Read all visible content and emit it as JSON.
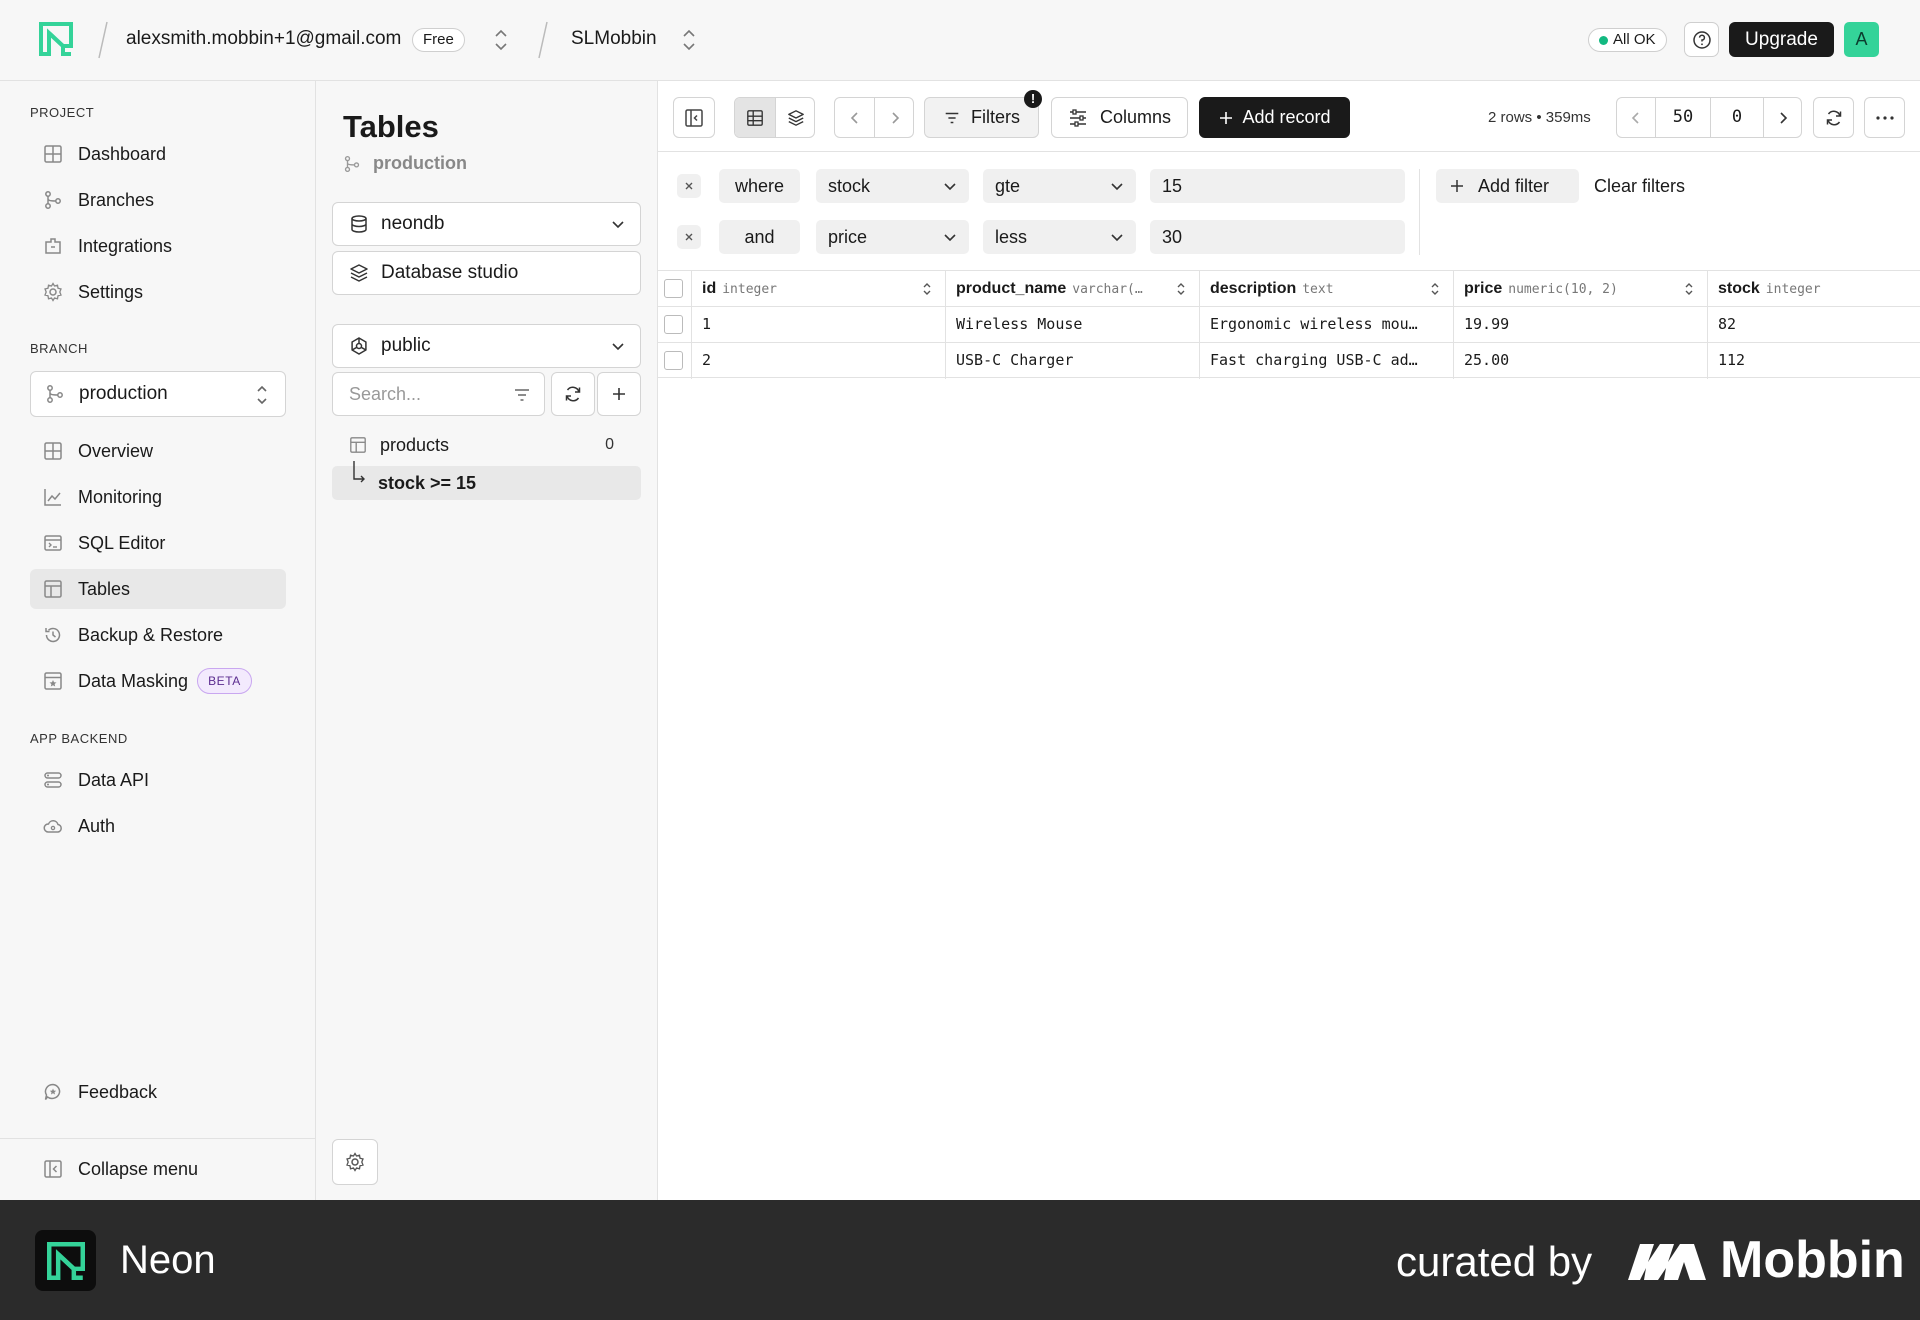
{
  "topbar": {
    "account_email": "alexsmith.mobbin+1@gmail.com",
    "plan_badge": "Free",
    "project_name": "SLMobbin",
    "status": "All OK",
    "upgrade_label": "Upgrade",
    "avatar_letter": "A"
  },
  "sidebar": {
    "project_label": "PROJECT",
    "project_items": [
      "Dashboard",
      "Branches",
      "Integrations",
      "Settings"
    ],
    "branch_label": "BRANCH",
    "branch_value": "production",
    "branch_items": [
      "Overview",
      "Monitoring",
      "SQL Editor",
      "Tables",
      "Backup & Restore",
      "Data Masking"
    ],
    "beta_badge": "BETA",
    "app_backend_label": "APP BACKEND",
    "backend_items": [
      "Data API",
      "Auth"
    ],
    "feedback_label": "Feedback",
    "collapse_label": "Collapse menu"
  },
  "tables_panel": {
    "title": "Tables",
    "branch": "production",
    "database": "neondb",
    "studio_label": "Database studio",
    "schema": "public",
    "search_placeholder": "Search...",
    "table_name": "products",
    "table_count": "0",
    "filter_view": "stock >= 15"
  },
  "toolbar": {
    "filters_label": "Filters",
    "filters_badge": "!",
    "columns_label": "Columns",
    "add_record_label": "Add record",
    "rows_info": "2 rows • 359ms",
    "limit": "50",
    "offset": "0"
  },
  "filters": [
    {
      "conjunction": "where",
      "column": "stock",
      "operator": "gte",
      "value": "15"
    },
    {
      "conjunction": "and",
      "column": "price",
      "operator": "less",
      "value": "30"
    }
  ],
  "filter_actions": {
    "add_filter": "Add filter",
    "clear_filters": "Clear filters"
  },
  "grid": {
    "columns": [
      {
        "name": "id",
        "type": "integer"
      },
      {
        "name": "product_name",
        "type": "varchar(…"
      },
      {
        "name": "description",
        "type": "text"
      },
      {
        "name": "price",
        "type": "numeric(10, 2)"
      },
      {
        "name": "stock",
        "type": "integer"
      }
    ],
    "rows": [
      [
        "1",
        "Wireless Mouse",
        "Ergonomic wireless mou…",
        "19.99",
        "82"
      ],
      [
        "2",
        "USB-C Charger",
        "Fast charging USB-C ad…",
        "25.00",
        "112"
      ]
    ]
  },
  "footer": {
    "brand": "Neon",
    "curated_by": "curated by",
    "mobbin": "Mobbin"
  },
  "colors": {
    "accent_green": "#34d399",
    "status_green": "#12b981",
    "dark": "#1a1a1a",
    "footer_bg": "#2b2b2b"
  },
  "icons": [
    "neon-logo",
    "chevron-updown-icon",
    "help-circle-icon",
    "grid-icon",
    "branch-icon",
    "plug-icon",
    "gear-icon",
    "chart-icon",
    "terminal-icon",
    "table-icon",
    "history-icon",
    "mask-icon",
    "api-icon",
    "cloud-icon",
    "feedback-icon",
    "collapse-icon",
    "database-icon",
    "layers-icon",
    "schema-icon",
    "filter-icon",
    "refresh-icon",
    "plus-icon",
    "sidebar-toggle-icon",
    "chevron-left-icon",
    "chevron-right-icon",
    "columns-icon",
    "more-icon",
    "close-icon",
    "chevron-down-icon",
    "sort-icon"
  ]
}
